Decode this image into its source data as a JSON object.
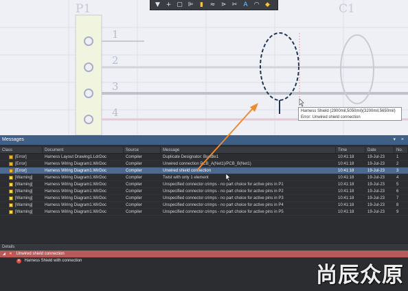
{
  "canvas": {
    "ghost_labels": [
      "P1",
      "C1"
    ],
    "pin_numbers": [
      "1",
      "2",
      "3",
      "4"
    ],
    "toolbar_icons": [
      "filter-icon",
      "plus-icon",
      "rectangle-icon",
      "align-icon",
      "component-icon",
      "wire-icon",
      "harness-icon",
      "cut-icon",
      "text-icon",
      "arc-icon",
      "shape-icon"
    ],
    "tooltip": {
      "line1": "Harness Shield (2900mil,5050mil)(3200mil,5650mil)",
      "line2": "Error: Unwired shield connection"
    }
  },
  "panel": {
    "title": "Messages",
    "title_buttons": "▾ ×",
    "columns": [
      "Class",
      "Document",
      "Source",
      "Message",
      "Time",
      "Date",
      "No."
    ],
    "rows": [
      {
        "class": "[Error]",
        "severity": "error",
        "document": "Harness Layout Drawing1.LdrDoc",
        "source": "Compiler",
        "message": "Duplicate Designator: Bundle1",
        "time": "10:41:18",
        "date": "19-Jul-23",
        "no": "1",
        "selected": false
      },
      {
        "class": "[Error]",
        "severity": "error",
        "document": "Harness Wiring Diagram1.WirDoc",
        "source": "Compiler",
        "message": "Unwired connection PCB_A(Net1)/PCB_B(Net1)",
        "time": "10:41:18",
        "date": "19-Jul-23",
        "no": "2",
        "selected": false
      },
      {
        "class": "[Error]",
        "severity": "error",
        "document": "Harness Wiring Diagram1.WirDoc",
        "source": "Compiler",
        "message": "Unwired shield connection",
        "time": "10:41:18",
        "date": "19-Jul-23",
        "no": "3",
        "selected": true
      },
      {
        "class": "[Warning]",
        "severity": "warning",
        "document": "Harness Wiring Diagram1.WirDoc",
        "source": "Compiler",
        "message": "Twist with only 1 element",
        "time": "10:41:18",
        "date": "19-Jul-23",
        "no": "4",
        "selected": false
      },
      {
        "class": "[Warning]",
        "severity": "warning",
        "document": "Harness Wiring Diagram1.WirDoc",
        "source": "Compiler",
        "message": "Unspecified connector crimps - no part choice for active pins in P1",
        "time": "10:41:18",
        "date": "19-Jul-23",
        "no": "5",
        "selected": false
      },
      {
        "class": "[Warning]",
        "severity": "warning",
        "document": "Harness Wiring Diagram1.WirDoc",
        "source": "Compiler",
        "message": "Unspecified connector crimps - no part choice for active pins in P2",
        "time": "10:41:18",
        "date": "19-Jul-23",
        "no": "6",
        "selected": false
      },
      {
        "class": "[Warning]",
        "severity": "warning",
        "document": "Harness Wiring Diagram1.WirDoc",
        "source": "Compiler",
        "message": "Unspecified connector crimps - no part choice for active pins in P3",
        "time": "10:41:18",
        "date": "19-Jul-23",
        "no": "7",
        "selected": false
      },
      {
        "class": "[Warning]",
        "severity": "warning",
        "document": "Harness Wiring Diagram1.WirDoc",
        "source": "Compiler",
        "message": "Unspecified connector crimps - no part choice for active pins in P4",
        "time": "10:41:18",
        "date": "19-Jul-23",
        "no": "8",
        "selected": false
      },
      {
        "class": "[Warning]",
        "severity": "warning",
        "document": "Harness Wiring Diagram1.WirDoc",
        "source": "Compiler",
        "message": "Unspecified connector crimps - no part choice for active pins in P5",
        "time": "10:41:18",
        "date": "19-Jul-23",
        "no": "9",
        "selected": false
      }
    ],
    "details": {
      "header": "Details",
      "main": "Unwired shield connection",
      "sub": "Harness Shield with connection"
    }
  },
  "watermark": "尚辰众原",
  "colors": {
    "error_row_highlight": "#b75a5a",
    "selected_row": "#4d6a8e",
    "panel_title": "#3f5f86",
    "arrow": "#f08a2c"
  }
}
